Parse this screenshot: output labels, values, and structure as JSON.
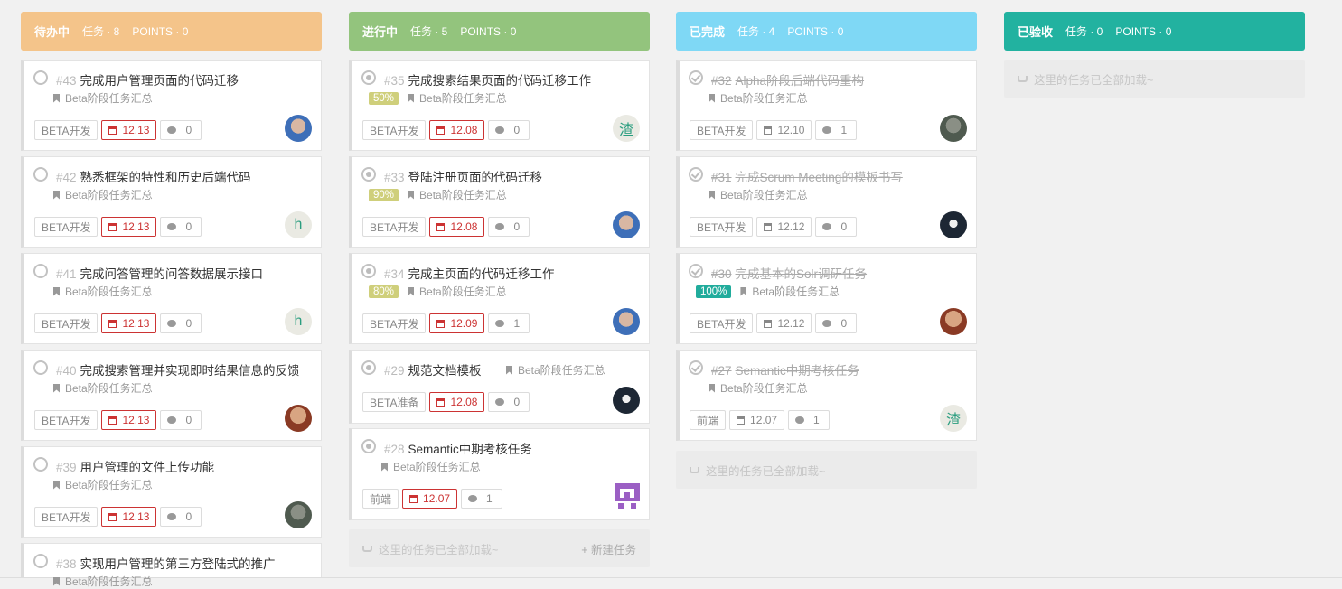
{
  "columns": [
    {
      "name": "待办中",
      "tasks_label": "任务 · 8",
      "points_label": "POINTS · 0",
      "color": "#f4c48a",
      "cards": [
        {
          "num": "#43",
          "title": "完成用户管理页面的代码迁移",
          "group": "Beta阶段任务汇总",
          "tag": "BETA开发",
          "due": "12.13",
          "comments": "0",
          "avatar": "photo-blue",
          "status": "todo"
        },
        {
          "num": "#42",
          "title": "熟悉框架的特性和历史后端代码",
          "group": "Beta阶段任务汇总",
          "tag": "BETA开发",
          "due": "12.13",
          "comments": "0",
          "avatar": "h",
          "status": "todo"
        },
        {
          "num": "#41",
          "title": "完成问答管理的问答数据展示接口",
          "group": "Beta阶段任务汇总",
          "tag": "BETA开发",
          "due": "12.13",
          "comments": "0",
          "avatar": "h",
          "status": "todo"
        },
        {
          "num": "#40",
          "title": "完成搜索管理并实现即时结果信息的反馈",
          "group": "Beta阶段任务汇总",
          "tag": "BETA开发",
          "due": "12.13",
          "comments": "0",
          "avatar": "photo-red",
          "status": "todo"
        },
        {
          "num": "#39",
          "title": "用户管理的文件上传功能",
          "group": "Beta阶段任务汇总",
          "tag": "BETA开发",
          "due": "12.13",
          "comments": "0",
          "avatar": "photo-green",
          "status": "todo"
        },
        {
          "num": "#38",
          "title": "实现用户管理的第三方登陆式的推广",
          "group": "Beta阶段任务汇总",
          "status": "todo"
        }
      ]
    },
    {
      "name": "进行中",
      "tasks_label": "任务 · 5",
      "points_label": "POINTS · 0",
      "color": "#93c47d",
      "cards": [
        {
          "num": "#35",
          "title": "完成搜索结果页面的代码迁移工作",
          "percent": "50%",
          "group": "Beta阶段任务汇总",
          "tag": "BETA开发",
          "due": "12.08",
          "comments": "0",
          "avatar": "渣",
          "status": "doing"
        },
        {
          "num": "#33",
          "title": "登陆注册页面的代码迁移",
          "percent": "90%",
          "group": "Beta阶段任务汇总",
          "tag": "BETA开发",
          "due": "12.08",
          "comments": "0",
          "avatar": "photo-blue",
          "status": "doing"
        },
        {
          "num": "#34",
          "title": "完成主页面的代码迁移工作",
          "percent": "80%",
          "group": "Beta阶段任务汇总",
          "tag": "BETA开发",
          "due": "12.09",
          "comments": "1",
          "avatar": "photo-blue",
          "status": "doing"
        },
        {
          "num": "#29",
          "title": "规范文档模板",
          "group": "Beta阶段任务汇总",
          "tag": "BETA准备",
          "due": "12.08",
          "comments": "0",
          "avatar": "photo-dark",
          "status": "doing"
        },
        {
          "num": "#28",
          "title": "Semantic中期考核任务",
          "group": "Beta阶段任务汇总",
          "tag": "前端",
          "due": "12.07",
          "comments": "1",
          "avatar": "identicon",
          "status": "doing"
        }
      ],
      "footer": "这里的任务已全部加载~",
      "new_task": "+ 新建任务"
    },
    {
      "name": "已完成",
      "tasks_label": "任务 · 4",
      "points_label": "POINTS · 0",
      "color": "#7fd8f5",
      "cards": [
        {
          "num": "#32",
          "title": "Alpha阶段后端代码重构",
          "group": "Beta阶段任务汇总",
          "tag": "BETA开发",
          "due": "12.10",
          "comments": "1",
          "avatar": "photo-green",
          "status": "done"
        },
        {
          "num": "#31",
          "title": "完成Scrum Meeting的模板书写",
          "group": "Beta阶段任务汇总",
          "tag": "BETA开发",
          "due": "12.12",
          "comments": "0",
          "avatar": "photo-dark",
          "status": "done"
        },
        {
          "num": "#30",
          "title": "完成基本的Solr调研任务",
          "percent": "100%",
          "group": "Beta阶段任务汇总",
          "tag": "BETA开发",
          "due": "12.12",
          "comments": "0",
          "avatar": "photo-red",
          "status": "done"
        },
        {
          "num": "#27",
          "title": "Semantic中期考核任务",
          "group": "Beta阶段任务汇总",
          "tag": "前端",
          "due": "12.07",
          "comments": "1",
          "avatar": "渣",
          "status": "done"
        }
      ],
      "footer": "这里的任务已全部加载~"
    },
    {
      "name": "已验收",
      "tasks_label": "任务 · 0",
      "points_label": "POINTS · 0",
      "color": "#22b2a0",
      "cards": [],
      "footer": "这里的任务已全部加载~"
    }
  ]
}
